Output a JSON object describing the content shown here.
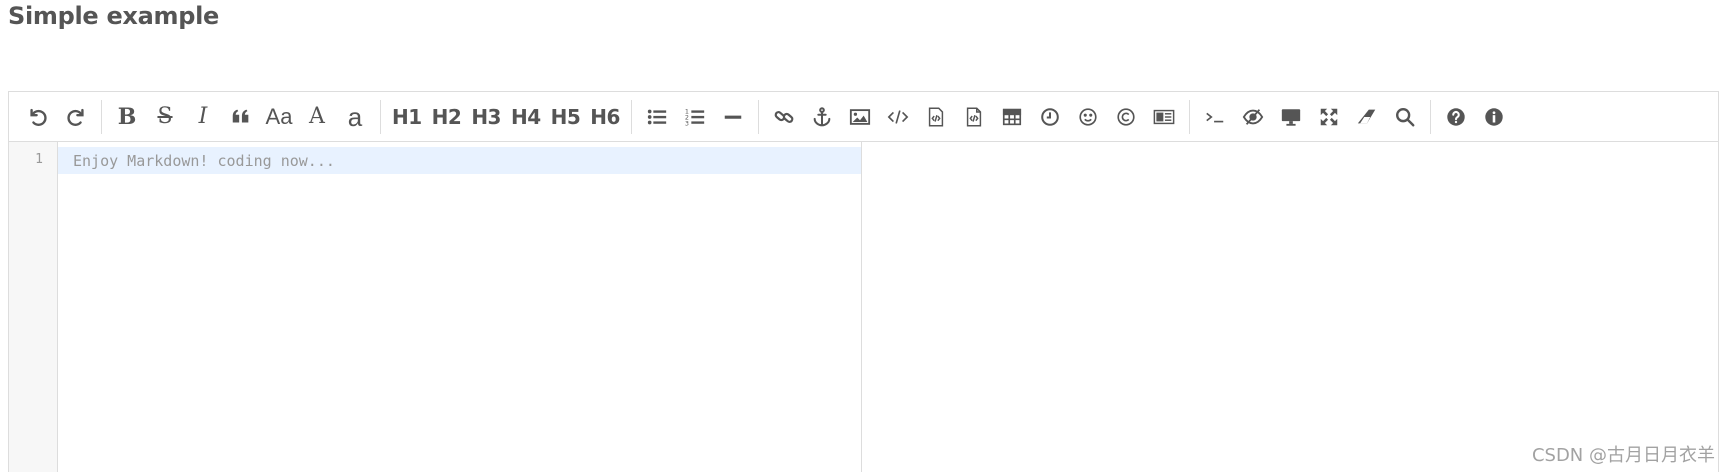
{
  "page": {
    "title": "Simple example"
  },
  "toolbar": {
    "groups": [
      [
        "undo-icon",
        "redo-icon"
      ],
      [
        "bold-icon",
        "strikethrough-icon",
        "italic-icon",
        "quote-icon",
        "uppercase-first-icon",
        "uppercase-icon",
        "lowercase-icon"
      ],
      [
        "h1",
        "h2",
        "h3",
        "h4",
        "h5",
        "h6"
      ],
      [
        "list-ul-icon",
        "list-ol-icon",
        "hr-icon"
      ],
      [
        "link-icon",
        "anchor-icon",
        "image-icon",
        "code-icon",
        "preformatted-text-icon",
        "code-block-icon",
        "table-icon",
        "datetime-icon",
        "emoji-icon",
        "html-entities-icon",
        "pagebreak-icon"
      ],
      [
        "goto-line-icon",
        "watch-icon",
        "preview-icon",
        "fullscreen-icon",
        "clear-icon",
        "search-icon"
      ],
      [
        "help-icon",
        "info-icon"
      ]
    ],
    "labels": {
      "bold": "B",
      "strikethrough": "S",
      "italic": "I",
      "uppercase_first": "Aa",
      "uppercase": "A",
      "lowercase": "a",
      "h1": "H1",
      "h2": "H2",
      "h3": "H3",
      "h4": "H4",
      "h5": "H5",
      "h6": "H6"
    }
  },
  "editor": {
    "line_numbers": [
      "1"
    ],
    "placeholder": "Enjoy Markdown! coding now..."
  },
  "watermark": "CSDN @古月日月衣羊"
}
